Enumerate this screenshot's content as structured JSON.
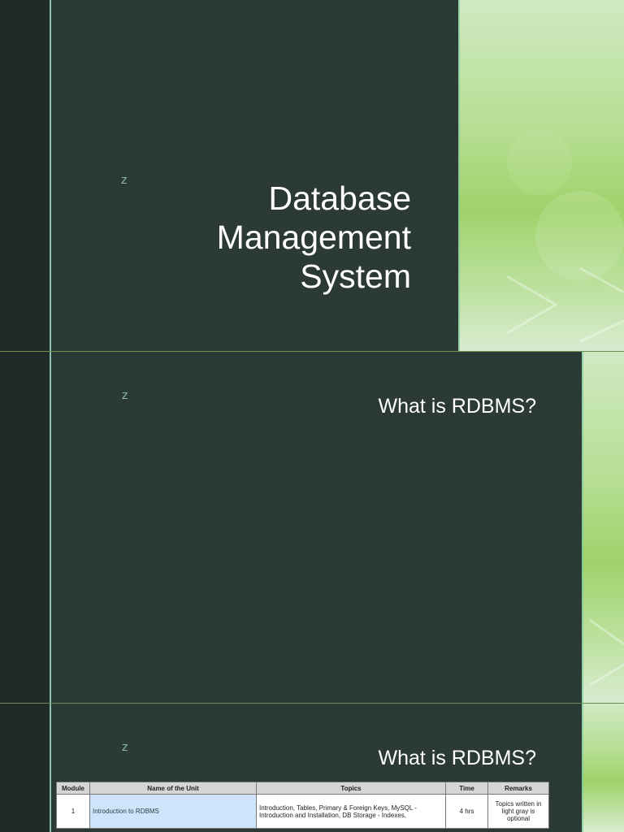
{
  "slides": [
    {
      "mark": "z",
      "title_lines": [
        "Database",
        "Management",
        "System"
      ]
    },
    {
      "mark": "z",
      "title": "What is RDBMS?"
    },
    {
      "mark": "z",
      "title": "What is RDBMS?",
      "table": {
        "headers": [
          "Module",
          "Name of the Unit",
          "Topics",
          "Time",
          "Remarks"
        ],
        "rows": [
          {
            "module": "1",
            "unit": "Introduction to RDBMS",
            "topics": "Introduction, Tables, Primary & Foreign Keys, MySQL - Introduction and Installation, DB Storage - Indexes,",
            "time": "4 hrs",
            "remarks": "Topics written in light gray is optional"
          }
        ]
      }
    }
  ],
  "colors": {
    "background": "#2b3833",
    "accent_line": "#8fbfb4",
    "green_panel": "#b7df95",
    "divider": "#6f8f52"
  }
}
